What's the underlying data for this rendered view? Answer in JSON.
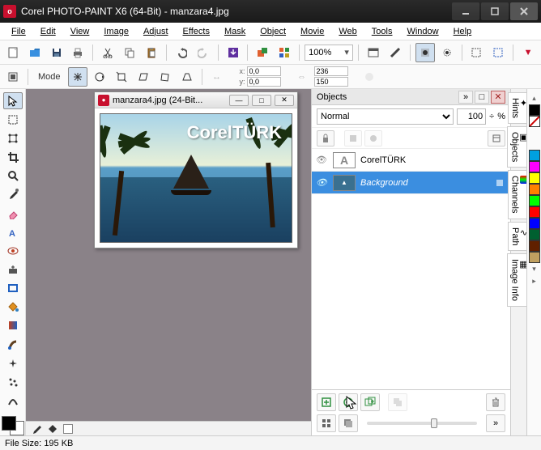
{
  "title": "Corel PHOTO-PAINT X6 (64-Bit) - manzara4.jpg",
  "app_icon_text": "o",
  "menu": [
    "File",
    "Edit",
    "View",
    "Image",
    "Adjust",
    "Effects",
    "Mask",
    "Object",
    "Movie",
    "Web",
    "Tools",
    "Window",
    "Help"
  ],
  "zoom": "100%",
  "propbar": {
    "mode_label": "Mode",
    "x": "0,0",
    "y": "0,0",
    "w": "236",
    "h": "150"
  },
  "document": {
    "title": "manzara4.jpg (24-Bit...",
    "watermark": "CorelTÜRK"
  },
  "objects": {
    "panel_title": "Objects",
    "blend_mode": "Normal",
    "opacity": "100",
    "opacity_suffix": "%",
    "rows": [
      {
        "name": "CorelTÜRK",
        "selected": false,
        "thumb": "text"
      },
      {
        "name": "Background",
        "selected": true,
        "thumb": "img"
      }
    ]
  },
  "side_tabs": [
    "Hints",
    "Objects",
    "Channels",
    "Path",
    "Image Info"
  ],
  "palette": [
    "#000000",
    "#ffffff",
    "#00a0e0",
    "#ff8000",
    "#ffff00",
    "#00c000",
    "#00ffff",
    "#0040ff",
    "#ff00ff",
    "#ff0000"
  ],
  "status": {
    "label": "File Size:",
    "value": "195 KB"
  }
}
